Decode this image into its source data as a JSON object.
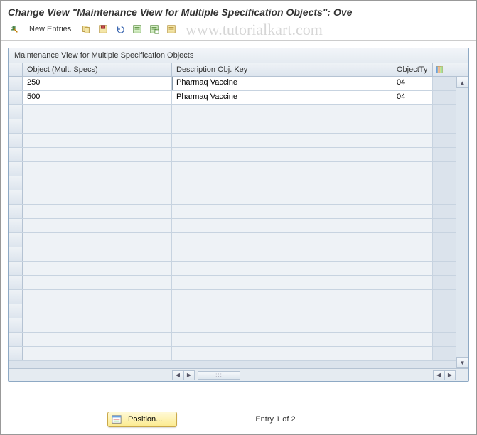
{
  "title": "Change View \"Maintenance View for Multiple Specification Objects\": Ove",
  "watermark": "www.tutorialkart.com",
  "toolbar": {
    "new_entries": "New Entries"
  },
  "panel": {
    "title": "Maintenance View for Multiple Specification Objects",
    "columns": {
      "object": "Object (Mult. Specs)",
      "description": "Description Obj. Key",
      "objtype": "ObjectTy"
    },
    "rows": [
      {
        "object": "250",
        "description": "Pharmaq Vaccine",
        "objtype": "04"
      },
      {
        "object": "500",
        "description": "Pharmaq Vaccine",
        "objtype": "04"
      }
    ]
  },
  "footer": {
    "position_label": "Position...",
    "entry_text": "Entry 1 of 2"
  }
}
